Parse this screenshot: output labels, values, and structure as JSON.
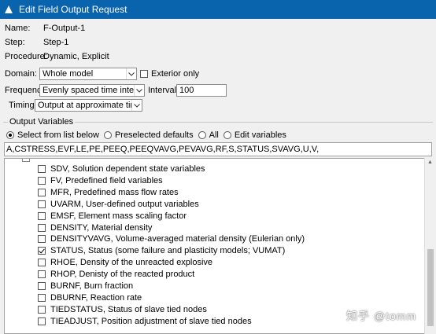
{
  "window": {
    "title": "Edit Field Output Request"
  },
  "info": {
    "name_label": "Name:",
    "name_value": "F-Output-1",
    "step_label": "Step:",
    "step_value": "Step-1",
    "procedure_label": "Procedure:",
    "procedure_value": "Dynamic, Explicit"
  },
  "domain": {
    "label": "Domain:",
    "value": "Whole model",
    "exterior_label": "Exterior only"
  },
  "frequency": {
    "label": "Frequency:",
    "value": "Evenly spaced time intervals",
    "interval_label": "Interval:",
    "interval_value": "100"
  },
  "timing": {
    "label": "Timing:",
    "value": "Output at approximate times"
  },
  "output_vars": {
    "title": "Output Variables",
    "radios": [
      "Select from list below",
      "Preselected defaults",
      "All",
      "Edit variables"
    ],
    "selected_radio": 0,
    "var_string": "A,CSTRESS,EVF,LE,PE,PEEQ,PEEQVAVG,PEVAVG,RF,S,STATUS,SVAVG,U,V,",
    "items": [
      {
        "label": "SDV, Solution dependent state variables",
        "checked": false
      },
      {
        "label": "FV, Predefined field variables",
        "checked": false
      },
      {
        "label": "MFR, Predefined mass flow rates",
        "checked": false
      },
      {
        "label": "UVARM, User-defined output variables",
        "checked": false
      },
      {
        "label": "EMSF, Element mass scaling factor",
        "checked": false
      },
      {
        "label": "DENSITY, Material density",
        "checked": false
      },
      {
        "label": "DENSITYVAVG, Volume-averaged material density (Eulerian only)",
        "checked": false
      },
      {
        "label": "STATUS, Status (some failure and plasticity models; VUMAT)",
        "checked": true
      },
      {
        "label": "RHOE, Density of the unreacted explosive",
        "checked": false
      },
      {
        "label": "RHOP, Denisty of the reacted product",
        "checked": false
      },
      {
        "label": "BURNF, Burn fraction",
        "checked": false
      },
      {
        "label": "DBURNF, Reaction rate",
        "checked": false
      },
      {
        "label": "TIEDSTATUS, Status of slave tied nodes",
        "checked": false
      },
      {
        "label": "TIEADJUST, Position adjustment of slave tied nodes",
        "checked": false
      }
    ]
  },
  "watermark": "知乎 @tomm"
}
